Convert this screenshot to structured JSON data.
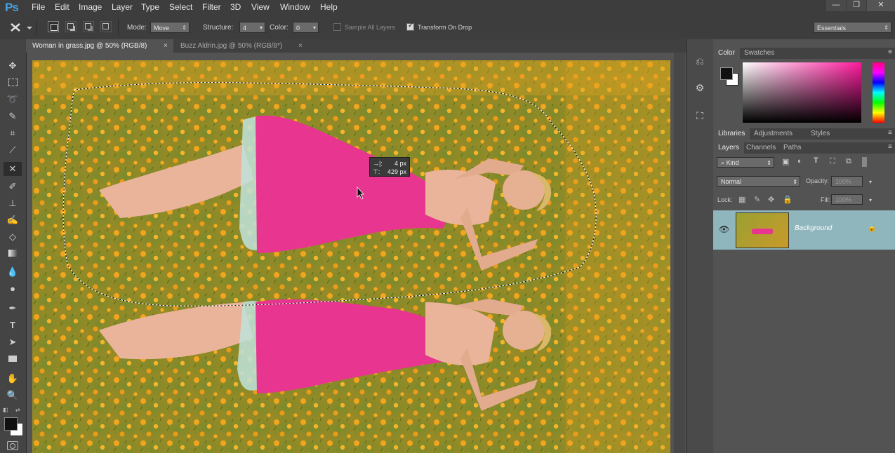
{
  "app": {
    "logo": "Ps"
  },
  "menu": [
    "File",
    "Edit",
    "Image",
    "Layer",
    "Type",
    "Select",
    "Filter",
    "3D",
    "View",
    "Window",
    "Help"
  ],
  "window_controls": {
    "minimize": "—",
    "restore": "❐",
    "close": "✕"
  },
  "options_bar": {
    "mode_label": "Mode:",
    "mode_value": "Move",
    "structure_label": "Structure:",
    "structure_value": "4",
    "color_label": "Color:",
    "color_value": "0",
    "sample_all_layers": "Sample All Layers",
    "sample_all_layers_checked": false,
    "transform_on_drop": "Transform On Drop",
    "transform_on_drop_checked": true,
    "workspace": "Essentials"
  },
  "documents": [
    {
      "title": "Woman in grass.jpg @ 50% (RGB/8)",
      "active": true
    },
    {
      "title": "Buzz Aldrin.jpg @ 50% (RGB/8*)",
      "active": false
    }
  ],
  "move_tooltip": {
    "dx": "4 px",
    "dy": "429 px"
  },
  "color_panel": {
    "tabs": [
      "Color",
      "Swatches"
    ],
    "foreground": "#111111",
    "background": "#ffffff"
  },
  "library_tabs": [
    "Libraries",
    "Adjustments",
    "Styles"
  ],
  "layers_panel": {
    "tabs": [
      "Layers",
      "Channels",
      "Paths"
    ],
    "filter_kind": "Kind",
    "blend_mode": "Normal",
    "opacity_label": "Opacity:",
    "opacity_value": "100%",
    "lock_label": "Lock:",
    "fill_label": "Fill:",
    "fill_value": "100%",
    "layers": [
      {
        "name": "Background",
        "visible": true,
        "locked": true
      }
    ]
  },
  "colors": {
    "accent": "#4aa3e0",
    "layer_selected": "#8fb6bd",
    "dress": "#e8358f",
    "grass": "#7f8a2a",
    "flower": "#f2a11c"
  }
}
